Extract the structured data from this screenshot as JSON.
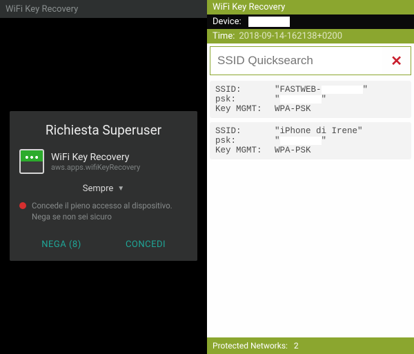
{
  "left": {
    "title": "WiFi Key Recovery",
    "dialog": {
      "title": "Richiesta Superuser",
      "app_name": "WiFi Key Recovery",
      "app_package": "aws.apps.wifiKeyRecovery",
      "duration_label": "Sempre",
      "warning": "Concede il pieno accesso al dispositivo. Nega se non sei sicuro",
      "deny_label": "NEGA (8)",
      "allow_label": "CONCEDI"
    }
  },
  "right": {
    "title": "WiFi Key Recovery",
    "device_label": "Device:",
    "device_value": "",
    "time_label": "Time:",
    "time_value": "2018-09-14-162138+0200",
    "search_placeholder": "SSID Quicksearch",
    "networks": [
      {
        "ssid": "\"FASTWEB-",
        "psk": "\"",
        "keymgmt": "WPA-PSK"
      },
      {
        "ssid": "\"iPhone di Irene\"",
        "psk": "\"",
        "keymgmt": "WPA-PSK"
      }
    ],
    "labels": {
      "ssid": "SSID:",
      "psk": "psk:",
      "keymgmt": "Key MGMT:"
    },
    "footer_label": "Protected Networks:",
    "footer_count": "2"
  }
}
